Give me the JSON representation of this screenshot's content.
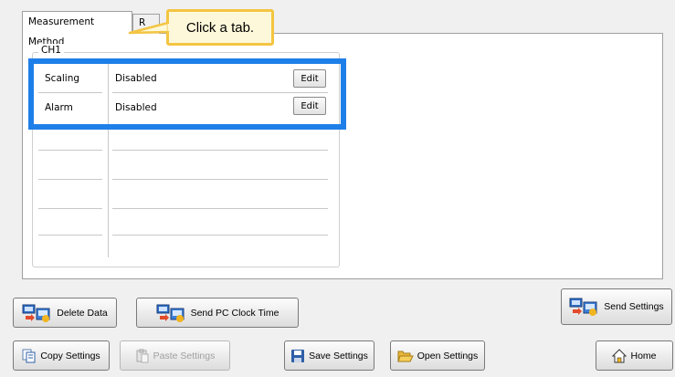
{
  "tabs": [
    {
      "label": "Measurement Method",
      "active": true
    },
    {
      "label": "R",
      "active": false
    }
  ],
  "callout": {
    "text": "Click a tab."
  },
  "group": {
    "label": "CH1"
  },
  "settings_rows": [
    {
      "name": "Scaling",
      "value": "Disabled",
      "button": "Edit"
    },
    {
      "name": "Alarm",
      "value": "Disabled",
      "button": "Edit"
    }
  ],
  "buttons": {
    "delete_data": "Delete Data",
    "send_clock": "Send PC Clock Time",
    "send_settings": "Send Settings",
    "copy_settings": "Copy Settings",
    "paste_settings": "Paste Settings",
    "save_settings": "Save Settings",
    "open_settings": "Open Settings",
    "home": "Home"
  },
  "colors": {
    "highlight": "#1e7fe8",
    "callout_border": "#f4c542",
    "callout_fill": "#fdf8d9"
  }
}
